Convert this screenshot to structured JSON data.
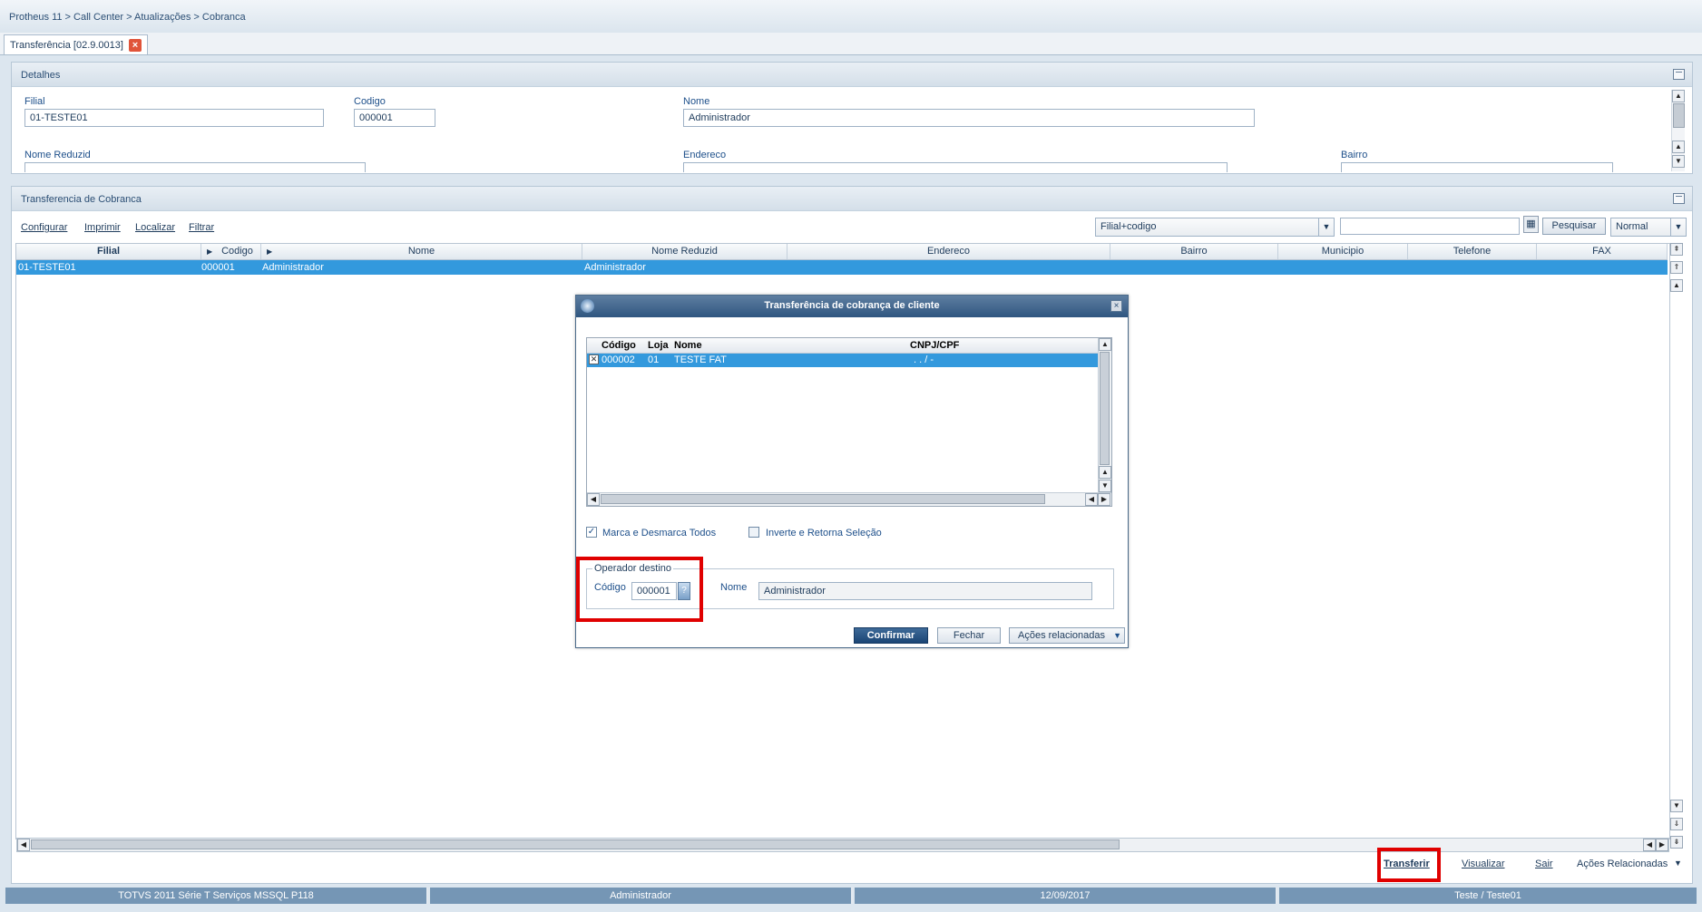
{
  "breadcrumb": "Protheus 11 > Call Center > Atualizações > Cobranca",
  "tab": {
    "label": "Transferência [02.9.0013]"
  },
  "details": {
    "title": "Detalhes",
    "fields": {
      "filial_label": "Filial",
      "filial_value": "01-TESTE01",
      "codigo_label": "Codigo",
      "codigo_value": "000001",
      "nome_label": "Nome",
      "nome_value": "Administrador",
      "nome_reduzid_label": "Nome Reduzid",
      "endereco_label": "Endereco",
      "bairro_label": "Bairro"
    }
  },
  "transfer_panel": {
    "title": "Transferencia de Cobranca",
    "links": [
      "Configurar",
      "Imprimir",
      "Localizar",
      "Filtrar"
    ],
    "search": {
      "index": "Filial+codigo",
      "value": "",
      "button": "Pesquisar",
      "mode": "Normal"
    },
    "columns": [
      "Filial",
      "Codigo",
      "Nome",
      "Nome Reduzid",
      "Endereco",
      "Bairro",
      "Municipio",
      "Telefone",
      "FAX"
    ],
    "rows": [
      {
        "filial": "01-TESTE01",
        "codigo": "000001",
        "nome": "Administrador",
        "nome_reduzid": "Administrador"
      }
    ]
  },
  "dialog": {
    "title": "Transferência de cobrança de cliente",
    "columns": [
      "Código",
      "Loja",
      "Nome",
      "CNPJ/CPF"
    ],
    "rows": [
      {
        "codigo": "000002",
        "loja": "01",
        "nome": "TESTE FAT",
        "cnpj": ".  .  /  -"
      }
    ],
    "check_all_label": "Marca e Desmarca Todos",
    "invert_label": "Inverte e Retorna Seleção",
    "group_title": "Operador destino",
    "codigo_label": "Código",
    "codigo_value": "000001",
    "nome_label": "Nome",
    "nome_value": "Administrador",
    "buttons": {
      "confirm": "Confirmar",
      "close": "Fechar",
      "actions": "Ações relacionadas"
    }
  },
  "bottom_actions": [
    "Transferir",
    "Visualizar",
    "Sair",
    "Ações Relacionadas"
  ],
  "status_bar": [
    "TOTVS 2011 Série T Serviços MSSQL P118",
    "Administrador",
    "12/09/2017",
    "Teste / Teste01"
  ],
  "colors": {
    "selection": "#3399dd",
    "highlight": "#e00000",
    "status": "#7596b5"
  }
}
